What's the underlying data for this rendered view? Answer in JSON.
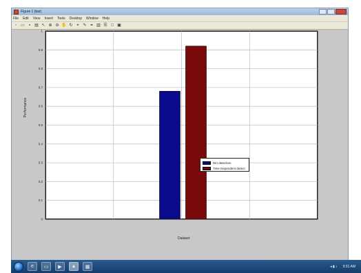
{
  "window": {
    "title": "Figure 1 (bar)",
    "menu": [
      "File",
      "Edit",
      "View",
      "Insert",
      "Tools",
      "Desktop",
      "Window",
      "Help"
    ]
  },
  "toolbar": {
    "icons": [
      "new-icon",
      "open-icon",
      "save-icon",
      "print-icon",
      "pointer-icon",
      "zoom-in-icon",
      "zoom-out-icon",
      "pan-icon",
      "rotate-icon",
      "data-cursor-icon",
      "brush-icon",
      "link-icon",
      "colorbar-icon",
      "legend-icon",
      "hide-plot-tools-icon",
      "show-plot-tools-icon"
    ]
  },
  "chart_data": {
    "type": "bar",
    "categories": [
      ""
    ],
    "series": [
      {
        "name": "Dirt detection",
        "values": [
          0.68
        ],
        "color": "#0a0a8c"
      },
      {
        "name": "Time Dependent detect",
        "values": [
          0.92
        ],
        "color": "#7a0a0a"
      }
    ],
    "title": "",
    "xlabel": "Dataset",
    "ylabel": "Performance",
    "ylim": [
      0,
      1
    ],
    "yticks": [
      "0",
      "0.1",
      "0.2",
      "0.3",
      "0.4",
      "0.5",
      "0.6",
      "0.7",
      "0.8",
      "0.9",
      "1"
    ],
    "grid": true,
    "legend_position": "right"
  },
  "taskbar": {
    "apps": [
      "ie-icon",
      "folder-icon",
      "media-icon",
      "matlab-icon",
      "figure-icon"
    ],
    "clock": "9:31 AM"
  }
}
